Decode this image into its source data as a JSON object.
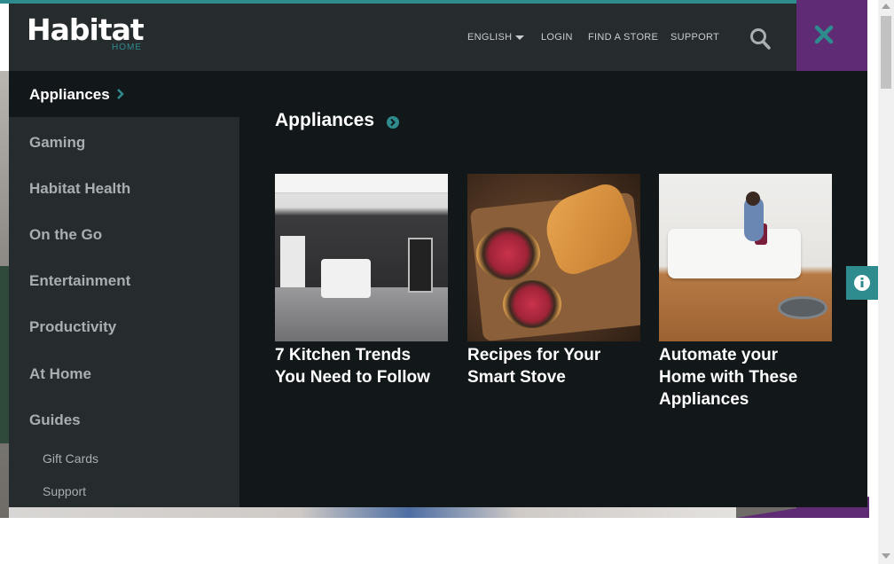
{
  "colors": {
    "accent_teal": "#2e8b8e",
    "header_bg": "#262b2d",
    "menu_bg": "#121819",
    "purple": "#5f2b75"
  },
  "header": {
    "logo_text": "Habitat",
    "logo_sub": "HOME",
    "nav": {
      "language": "ENGLISH",
      "login": "LOGIN",
      "find_store": "FIND A STORE",
      "support": "SUPPORT"
    },
    "icons": {
      "search": "search-icon",
      "close": "close-icon"
    }
  },
  "sidebar": {
    "active_item": "Appliances",
    "items": [
      {
        "label": "Gaming"
      },
      {
        "label": "Habitat Health"
      },
      {
        "label": "On the Go"
      },
      {
        "label": "Entertainment"
      },
      {
        "label": "Productivity"
      },
      {
        "label": "At Home"
      },
      {
        "label": "Guides"
      }
    ],
    "sub_items": [
      {
        "label": "Gift Cards"
      },
      {
        "label": "Support"
      }
    ]
  },
  "content": {
    "title": "Appliances",
    "cards": [
      {
        "title_line1": "7 Kitchen Trends",
        "title_line2": "You Need to Follow",
        "title_line3": ""
      },
      {
        "title_line1": "Recipes for Your",
        "title_line2": "Smart Stove",
        "title_line3": ""
      },
      {
        "title_line1": "Automate your",
        "title_line2": "Home with These",
        "title_line3": "Appliances"
      }
    ]
  },
  "info_tab": {
    "icon": "info-icon"
  }
}
